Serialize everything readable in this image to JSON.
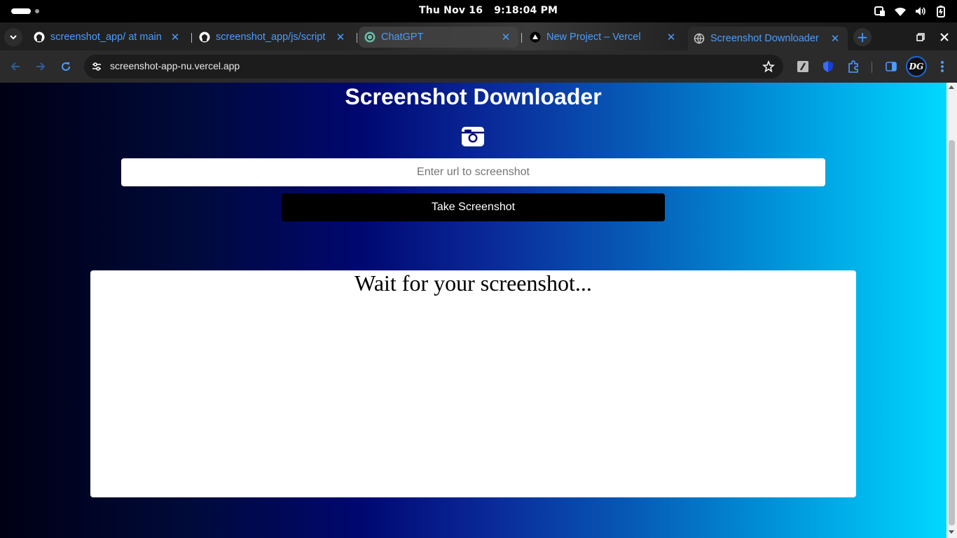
{
  "system": {
    "date": "Thu Nov 16",
    "time": "9:18:04 PM",
    "tray_icons": [
      "screen-share-icon",
      "wifi-icon",
      "volume-icon",
      "battery-icon"
    ]
  },
  "tabs": [
    {
      "title": "screenshot_app/ at main",
      "icon": "github-icon"
    },
    {
      "title": "screenshot_app/js/script",
      "icon": "github-icon"
    },
    {
      "title": "ChatGPT",
      "icon": "chatgpt-icon"
    },
    {
      "title": "New Project – Vercel",
      "icon": "vercel-icon"
    },
    {
      "title": "Screenshot Downloader",
      "icon": "globe-icon"
    }
  ],
  "toolbar": {
    "url": "screenshot-app-nu.vercel.app",
    "avatar_initials": "DG"
  },
  "page": {
    "title": "Screenshot Downloader",
    "input_placeholder": "Enter url to screenshot",
    "button_label": "Take Screenshot",
    "result_text": "Wait for your screenshot..."
  },
  "colors": {
    "accent": "#4a9dff",
    "gradient_start": "#000014",
    "gradient_mid": "#000770",
    "gradient_end": "#00d8ff"
  }
}
